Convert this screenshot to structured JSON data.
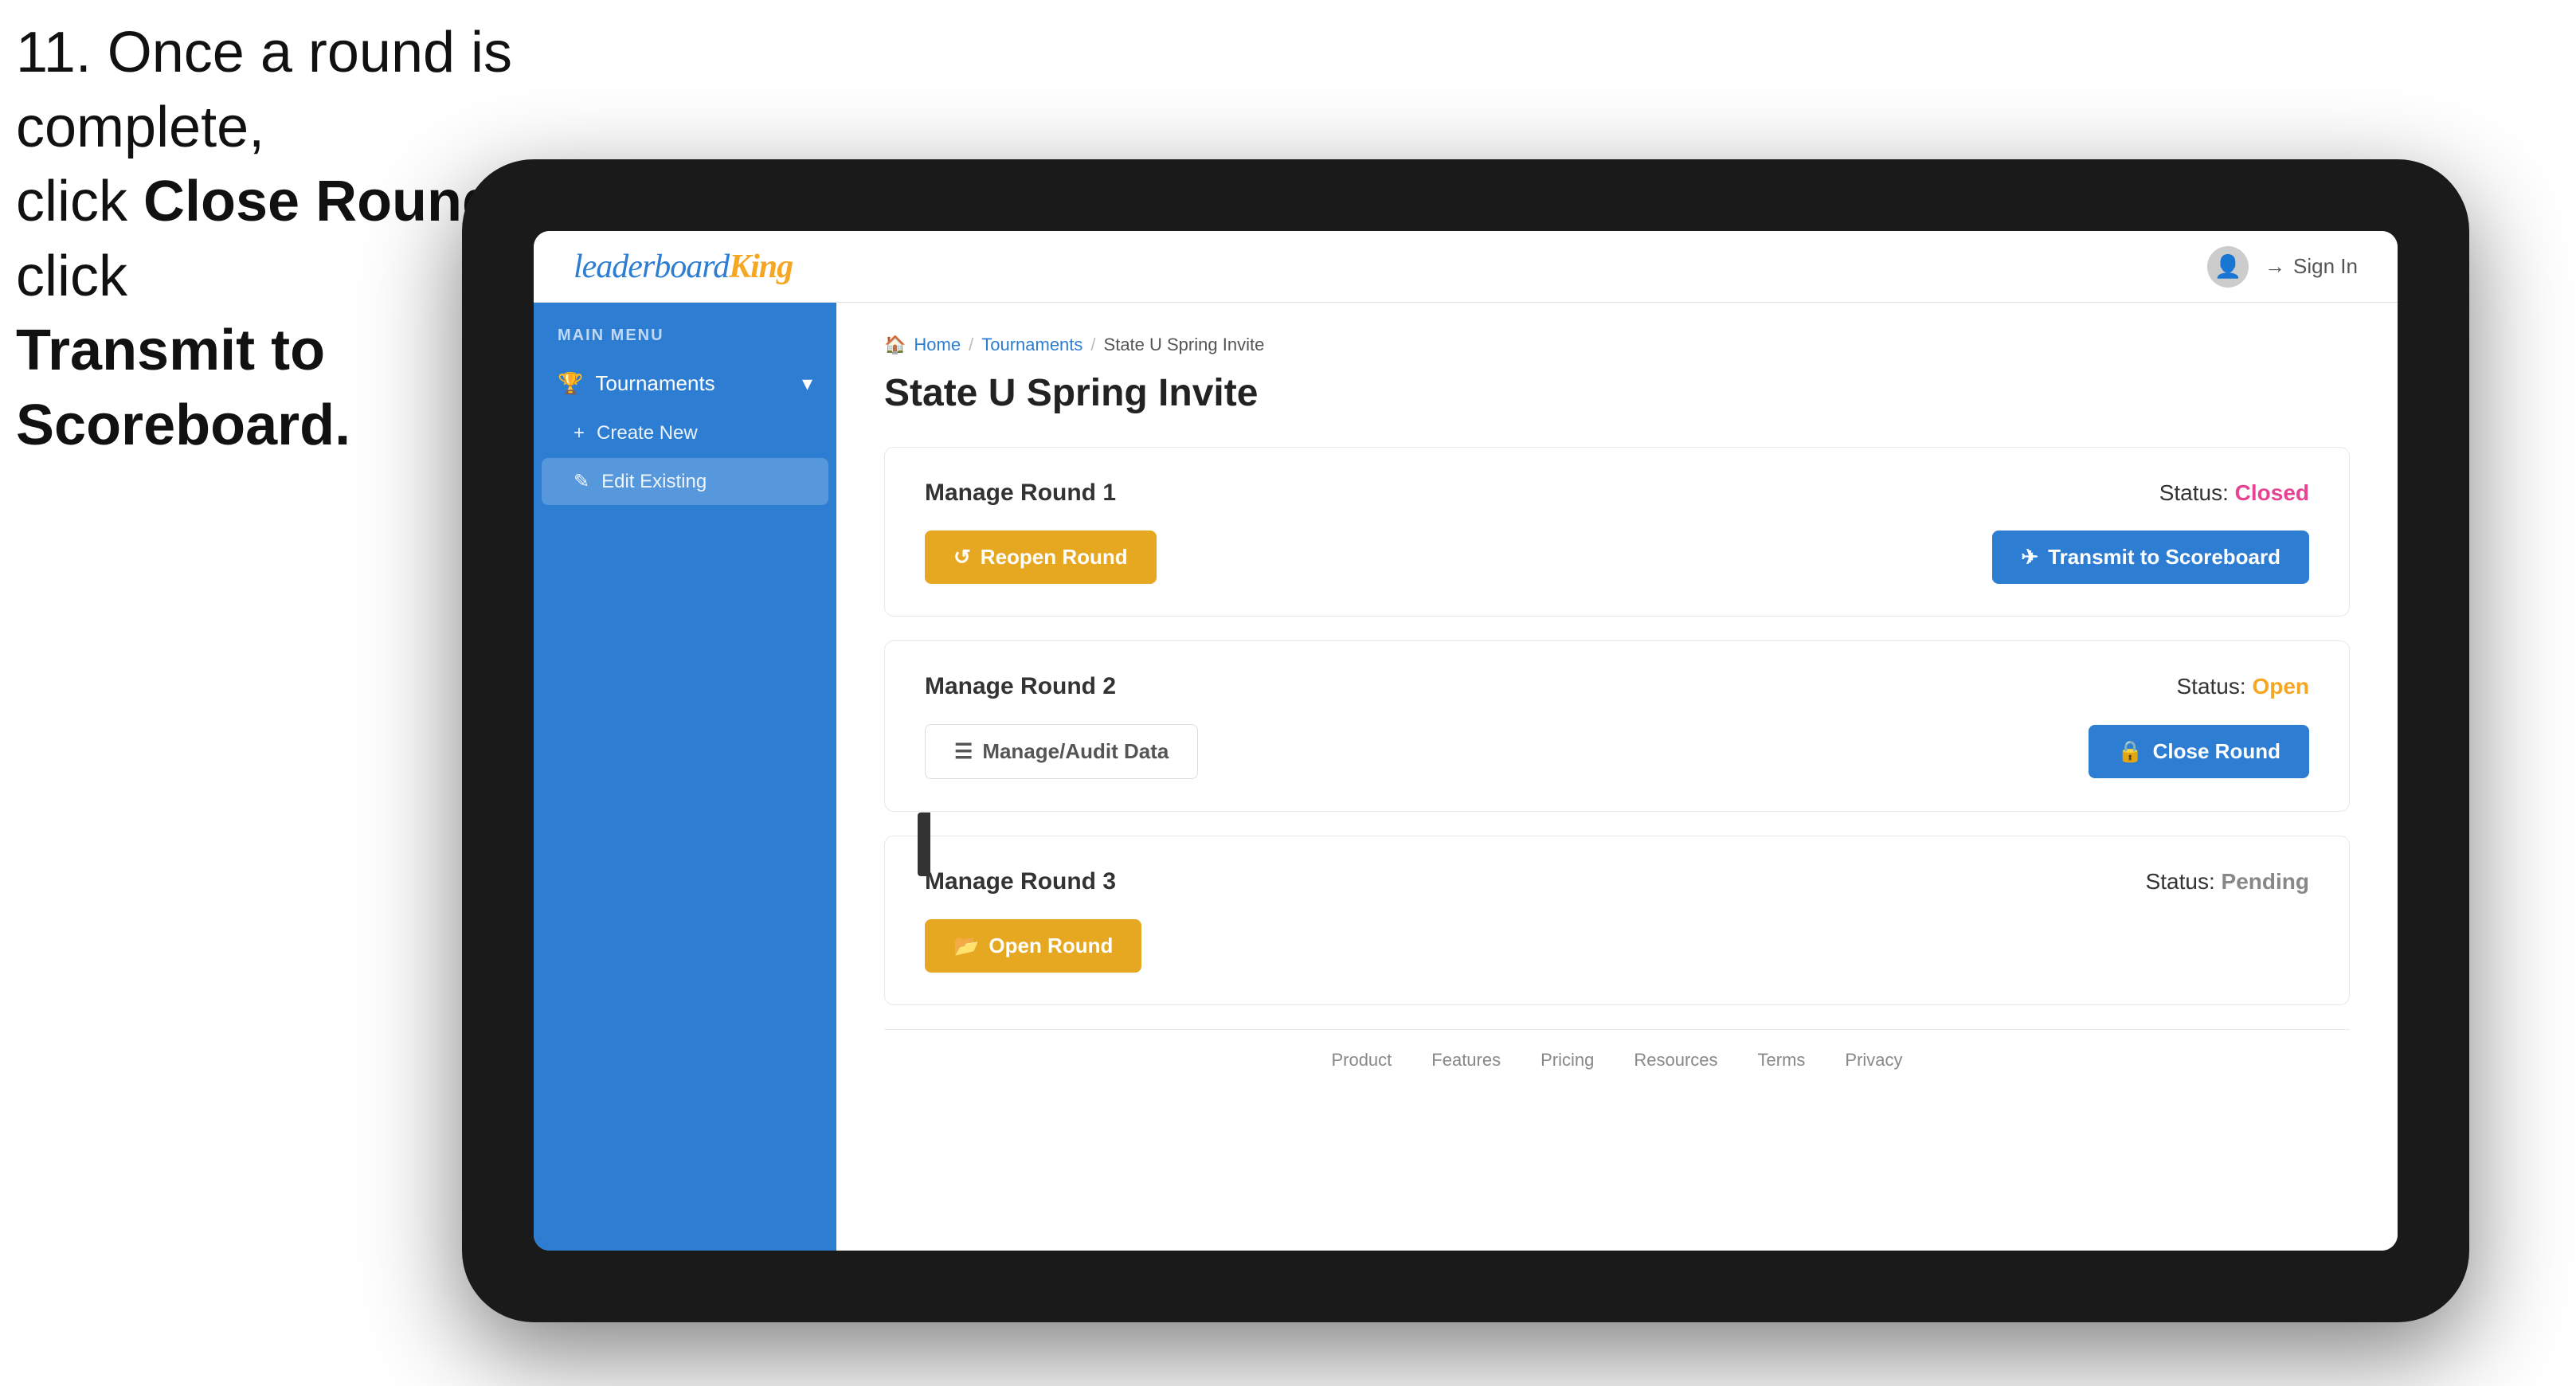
{
  "instruction": {
    "line1": "11. Once a round is complete,",
    "line2": "click ",
    "bold1": "Close Round",
    "line3": " then click",
    "bold2": "Transmit to Scoreboard."
  },
  "top_nav": {
    "logo_text": "leaderboard",
    "logo_king": "King",
    "sign_in": "Sign In"
  },
  "sidebar": {
    "section_label": "MAIN MENU",
    "tournaments_label": "Tournaments",
    "create_new_label": "Create New",
    "edit_existing_label": "Edit Existing"
  },
  "breadcrumb": {
    "home": "Home",
    "tournaments": "Tournaments",
    "current": "State U Spring Invite"
  },
  "page": {
    "title": "State U Spring Invite",
    "round1": {
      "label": "Manage Round 1",
      "status_label": "Status:",
      "status": "Closed",
      "btn_reopen": "Reopen Round",
      "btn_transmit": "Transmit to Scoreboard"
    },
    "round2": {
      "label": "Manage Round 2",
      "status_label": "Status:",
      "status": "Open",
      "btn_audit": "Manage/Audit Data",
      "btn_close": "Close Round"
    },
    "round3": {
      "label": "Manage Round 3",
      "status_label": "Status:",
      "status": "Pending",
      "btn_open": "Open Round"
    }
  },
  "footer": {
    "links": [
      "Product",
      "Features",
      "Pricing",
      "Resources",
      "Terms",
      "Privacy"
    ]
  },
  "colors": {
    "sidebar_bg": "#2d7dd2",
    "status_closed": "#e84393",
    "status_open": "#f5a623",
    "btn_gold": "#e6a820",
    "btn_blue": "#2d7dd2"
  }
}
